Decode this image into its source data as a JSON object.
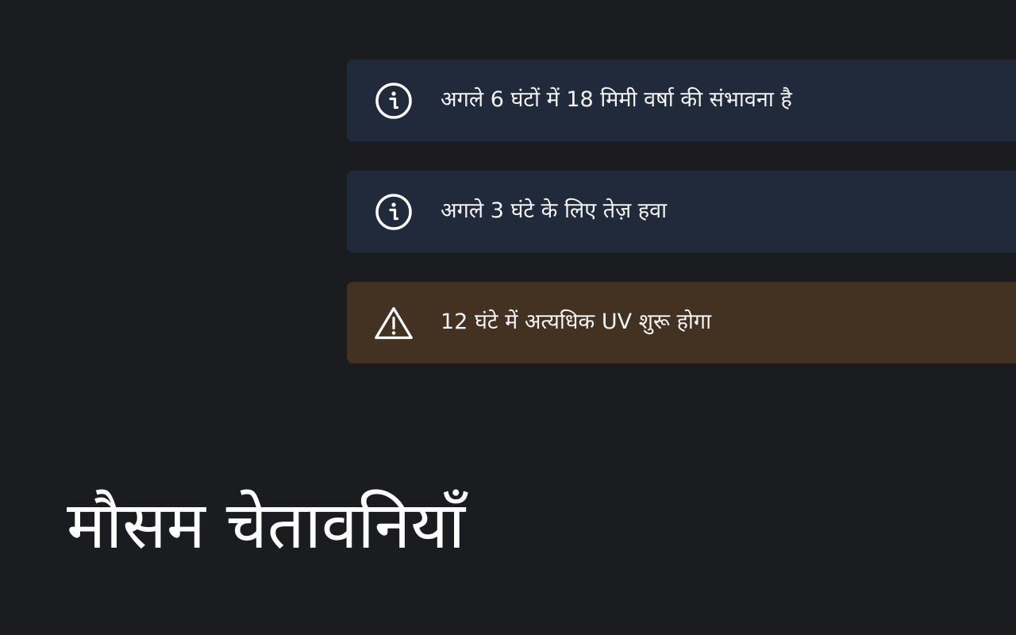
{
  "alerts": [
    {
      "type": "info",
      "icon": "info-icon",
      "message": "अगले 6 घंटों में 18 मिमी वर्षा की संभावना है"
    },
    {
      "type": "info",
      "icon": "info-icon",
      "message": "अगले 3 घंटे के लिए तेज़ हवा"
    },
    {
      "type": "warning",
      "icon": "warning-icon",
      "message": "12 घंटे में अत्यधिक UV शुरू होगा"
    }
  ],
  "page": {
    "title": "मौसम चेतावनियाँ"
  },
  "colors": {
    "background": "#1b1c1f",
    "info_card": "#212a3b",
    "warning_card": "#433121",
    "text": "#f4f4f4"
  }
}
